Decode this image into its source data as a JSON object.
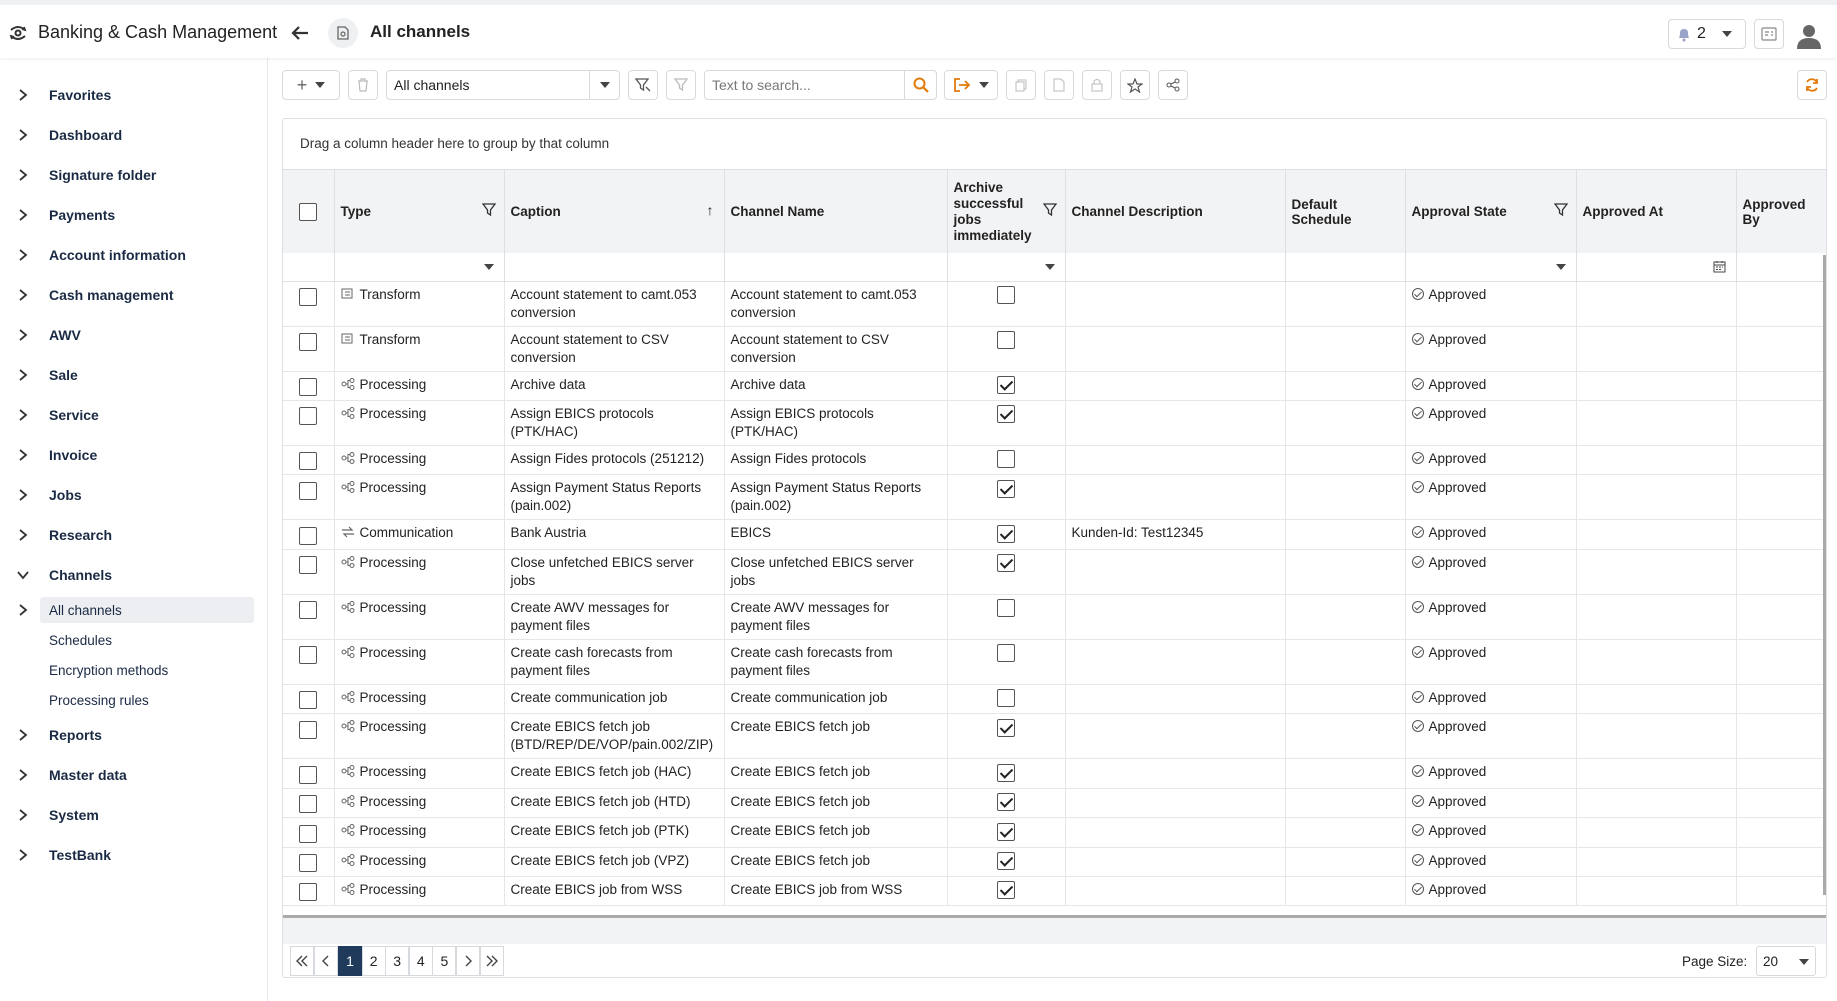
{
  "app": {
    "title": "Banking & Cash Management"
  },
  "header": {
    "page_title": "All channels",
    "notification_count": "2"
  },
  "sidebar": {
    "items": [
      {
        "label": "Favorites"
      },
      {
        "label": "Dashboard"
      },
      {
        "label": "Signature folder"
      },
      {
        "label": "Payments"
      },
      {
        "label": "Account information"
      },
      {
        "label": "Cash management"
      },
      {
        "label": "AWV"
      },
      {
        "label": "Sale"
      },
      {
        "label": "Service"
      },
      {
        "label": "Invoice"
      },
      {
        "label": "Jobs"
      },
      {
        "label": "Research"
      },
      {
        "label": "Channels"
      }
    ],
    "channels_sub": [
      {
        "label": "All channels"
      },
      {
        "label": "Schedules"
      },
      {
        "label": "Encryption methods"
      },
      {
        "label": "Processing rules"
      }
    ],
    "items_after": [
      {
        "label": "Reports"
      },
      {
        "label": "Master data"
      },
      {
        "label": "System"
      },
      {
        "label": "TestBank"
      }
    ]
  },
  "toolbar": {
    "view_select": "All channels",
    "search_placeholder": "Text to search..."
  },
  "grid": {
    "group_hint": "Drag a column header here to group by that column",
    "columns": {
      "type": "Type",
      "caption": "Caption",
      "channel_name": "Channel Name",
      "archive": "Archive successful jobs immediately",
      "description": "Channel Description",
      "default_schedule": "Default Schedule",
      "approval_state": "Approval State",
      "approved_at": "Approved At",
      "approved_by": "Approved By"
    },
    "rows": [
      {
        "type": "Transform",
        "caption": "Account statement to camt.053 conversion",
        "name": "Account statement to camt.053 conversion",
        "archive": false,
        "desc": "",
        "state": "Approved"
      },
      {
        "type": "Transform",
        "caption": "Account statement to CSV conversion",
        "name": "Account statement to CSV conversion",
        "archive": false,
        "desc": "",
        "state": "Approved"
      },
      {
        "type": "Processing",
        "caption": "Archive data",
        "name": "Archive data",
        "archive": true,
        "desc": "",
        "state": "Approved"
      },
      {
        "type": "Processing",
        "caption": "Assign EBICS protocols (PTK/HAC)",
        "name": "Assign EBICS protocols (PTK/HAC)",
        "archive": true,
        "desc": "",
        "state": "Approved"
      },
      {
        "type": "Processing",
        "caption": "Assign Fides protocols (251212)",
        "name": "Assign Fides protocols",
        "archive": false,
        "desc": "",
        "state": "Approved"
      },
      {
        "type": "Processing",
        "caption": "Assign Payment Status Reports (pain.002)",
        "name": "Assign Payment Status Reports (pain.002)",
        "archive": true,
        "desc": "",
        "state": "Approved"
      },
      {
        "type": "Communication",
        "caption": "Bank Austria",
        "name": "EBICS",
        "archive": true,
        "desc": "Kunden-Id: Test12345",
        "state": "Approved"
      },
      {
        "type": "Processing",
        "caption": "Close unfetched EBICS server jobs",
        "name": "Close unfetched EBICS server jobs",
        "archive": true,
        "desc": "",
        "state": "Approved"
      },
      {
        "type": "Processing",
        "caption": "Create AWV messages for payment files",
        "name": "Create AWV messages for payment files",
        "archive": false,
        "desc": "",
        "state": "Approved"
      },
      {
        "type": "Processing",
        "caption": "Create cash forecasts from payment files",
        "name": "Create cash forecasts from payment files",
        "archive": false,
        "desc": "",
        "state": "Approved"
      },
      {
        "type": "Processing",
        "caption": "Create communication job",
        "name": "Create communication job",
        "archive": false,
        "desc": "",
        "state": "Approved"
      },
      {
        "type": "Processing",
        "caption": "Create EBICS fetch job (BTD/REP/DE/VOP/pain.002/ZIP)",
        "name": "Create EBICS fetch job",
        "archive": true,
        "desc": "",
        "state": "Approved"
      },
      {
        "type": "Processing",
        "caption": "Create EBICS fetch job (HAC)",
        "name": "Create EBICS fetch job",
        "archive": true,
        "desc": "",
        "state": "Approved"
      },
      {
        "type": "Processing",
        "caption": "Create EBICS fetch job (HTD)",
        "name": "Create EBICS fetch job",
        "archive": true,
        "desc": "",
        "state": "Approved"
      },
      {
        "type": "Processing",
        "caption": "Create EBICS fetch job (PTK)",
        "name": "Create EBICS fetch job",
        "archive": true,
        "desc": "",
        "state": "Approved"
      },
      {
        "type": "Processing",
        "caption": "Create EBICS fetch job (VPZ)",
        "name": "Create EBICS fetch job",
        "archive": true,
        "desc": "",
        "state": "Approved"
      },
      {
        "type": "Processing",
        "caption": "Create EBICS job from WSS",
        "name": "Create EBICS job from WSS",
        "archive": true,
        "desc": "",
        "state": "Approved"
      }
    ]
  },
  "pager": {
    "pages": [
      "1",
      "2",
      "3",
      "4",
      "5"
    ],
    "current": "1",
    "page_size_label": "Page Size:",
    "page_size": "20"
  },
  "colors": {
    "accent_orange": "#e37b0b",
    "active_page": "#1f3a5a",
    "header_bg": "#f2f3f5"
  }
}
